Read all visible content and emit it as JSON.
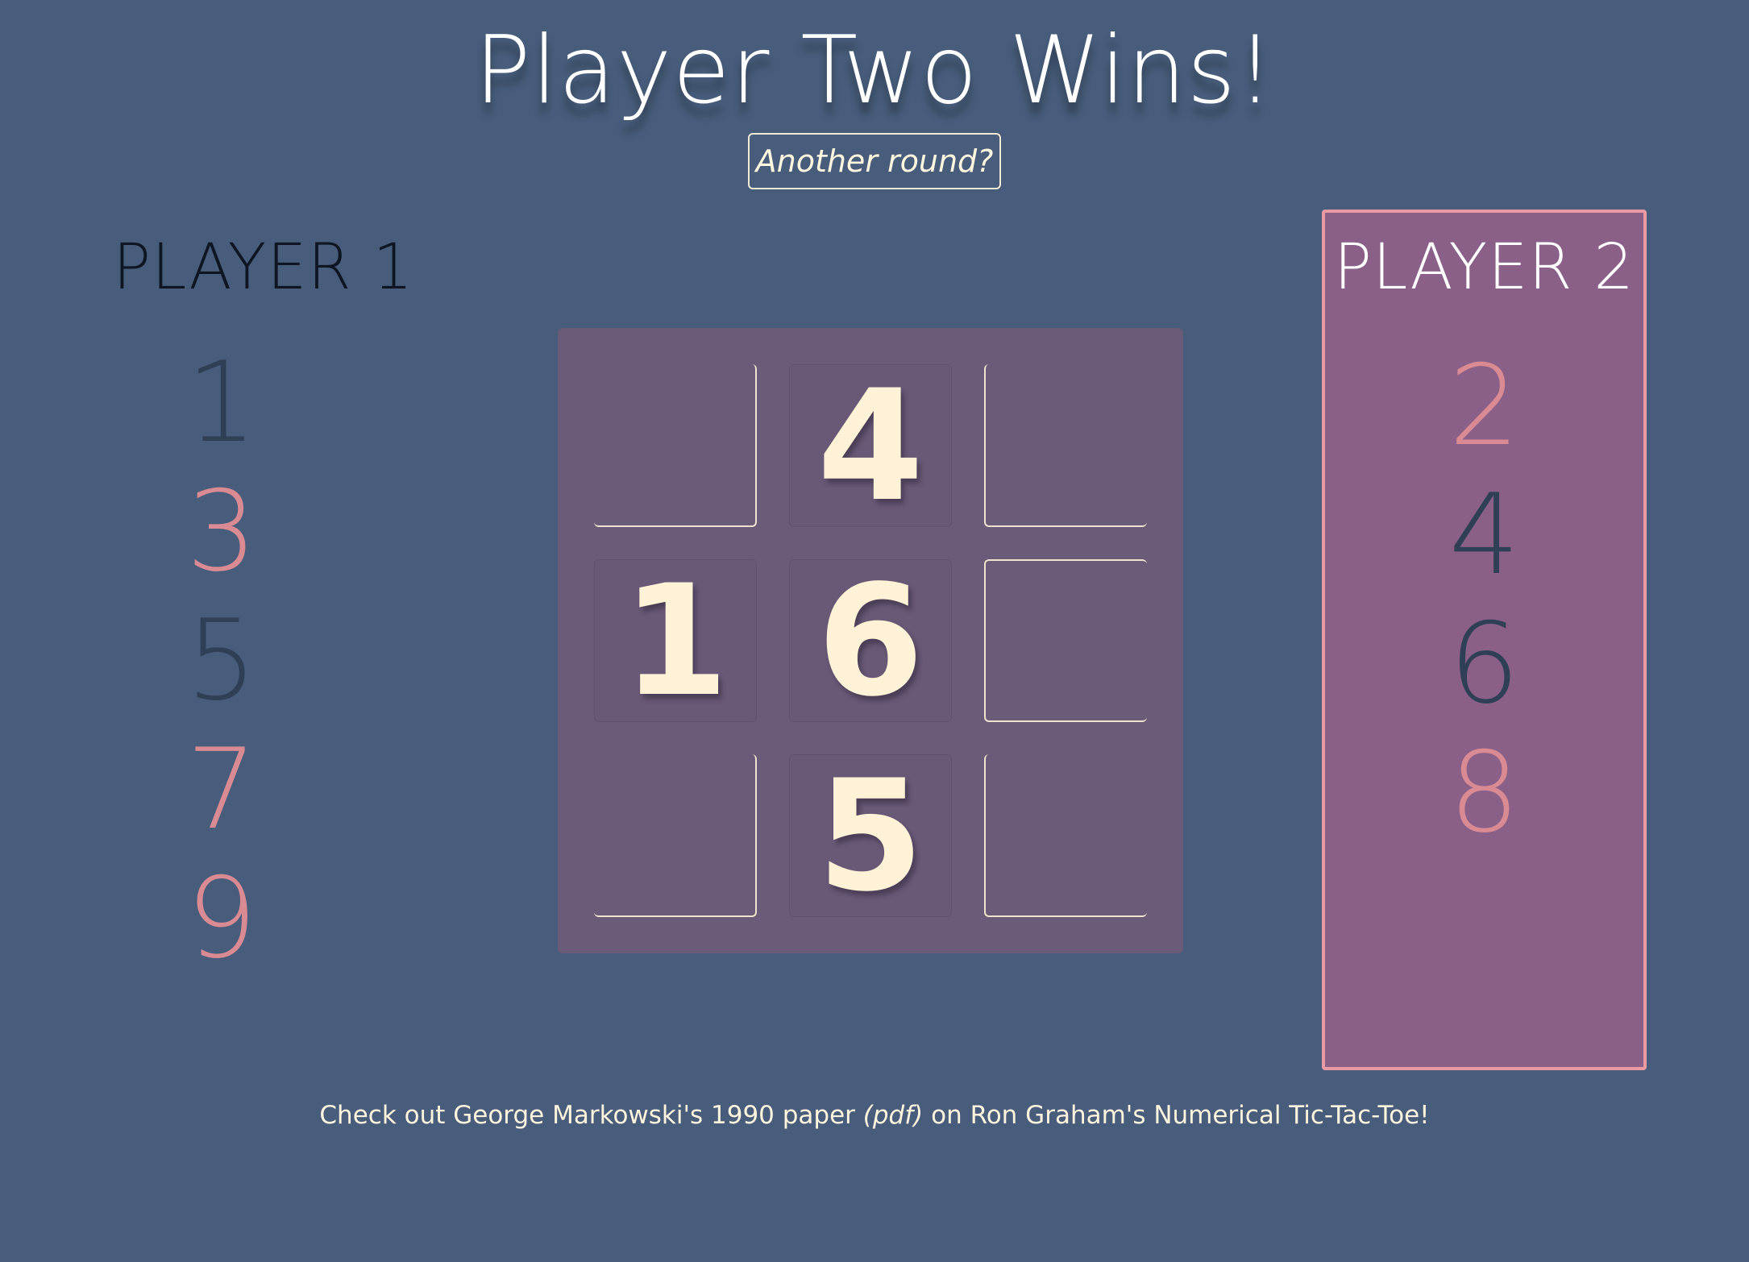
{
  "title": "Player Two Wins!",
  "again_button": "Another round?",
  "player1": {
    "name": "PLAYER 1",
    "active": false,
    "numbers": [
      {
        "value": "1",
        "used": true
      },
      {
        "value": "3",
        "used": false
      },
      {
        "value": "5",
        "used": true
      },
      {
        "value": "7",
        "used": false
      },
      {
        "value": "9",
        "used": false
      }
    ]
  },
  "player2": {
    "name": "PLAYER 2",
    "active": true,
    "numbers": [
      {
        "value": "2",
        "used": false
      },
      {
        "value": "4",
        "used": true
      },
      {
        "value": "6",
        "used": true
      },
      {
        "value": "8",
        "used": false
      }
    ]
  },
  "board": [
    [
      "",
      "4",
      ""
    ],
    [
      "1",
      "6",
      ""
    ],
    [
      "",
      "5",
      ""
    ]
  ],
  "footer": {
    "before": "Check out George Markowski's 1990 paper ",
    "link": "(pdf)",
    "after": " on Ron Graham's Numerical Tic-Tac-Toe!"
  },
  "colors": {
    "background": "#475d7b",
    "board": "#6a5b78",
    "active_panel": "#8a6088",
    "active_border": "#e99aa2",
    "number_available": "#d98a92",
    "number_used": "#2f3f55",
    "tile_text": "#fff2d6"
  }
}
